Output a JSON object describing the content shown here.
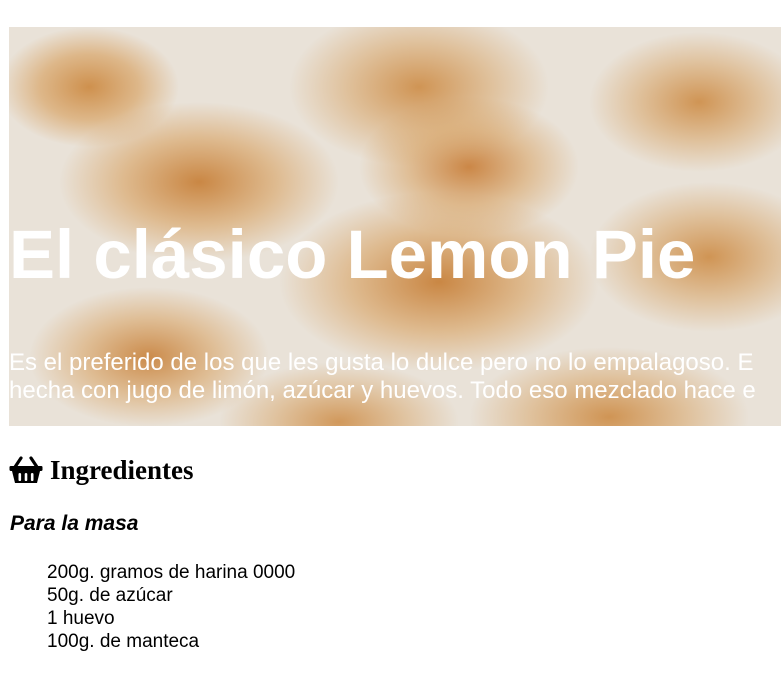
{
  "hero": {
    "title": "El clásico Lemon Pie",
    "description_lines": [
      "Es el preferido de los que les gusta lo dulce pero no lo empalagoso. E",
      "hecha con jugo de limón, azúcar y huevos. Todo eso mezclado hace e"
    ],
    "image_description": "meringue-topping-photo"
  },
  "ingredients": {
    "icon": "basket-icon",
    "title": "Ingredientes",
    "subsection_title": "Para la masa",
    "items": [
      "200g. gramos de harina 0000",
      "50g. de azúcar",
      "1 huevo",
      "100g. de manteca"
    ]
  }
}
